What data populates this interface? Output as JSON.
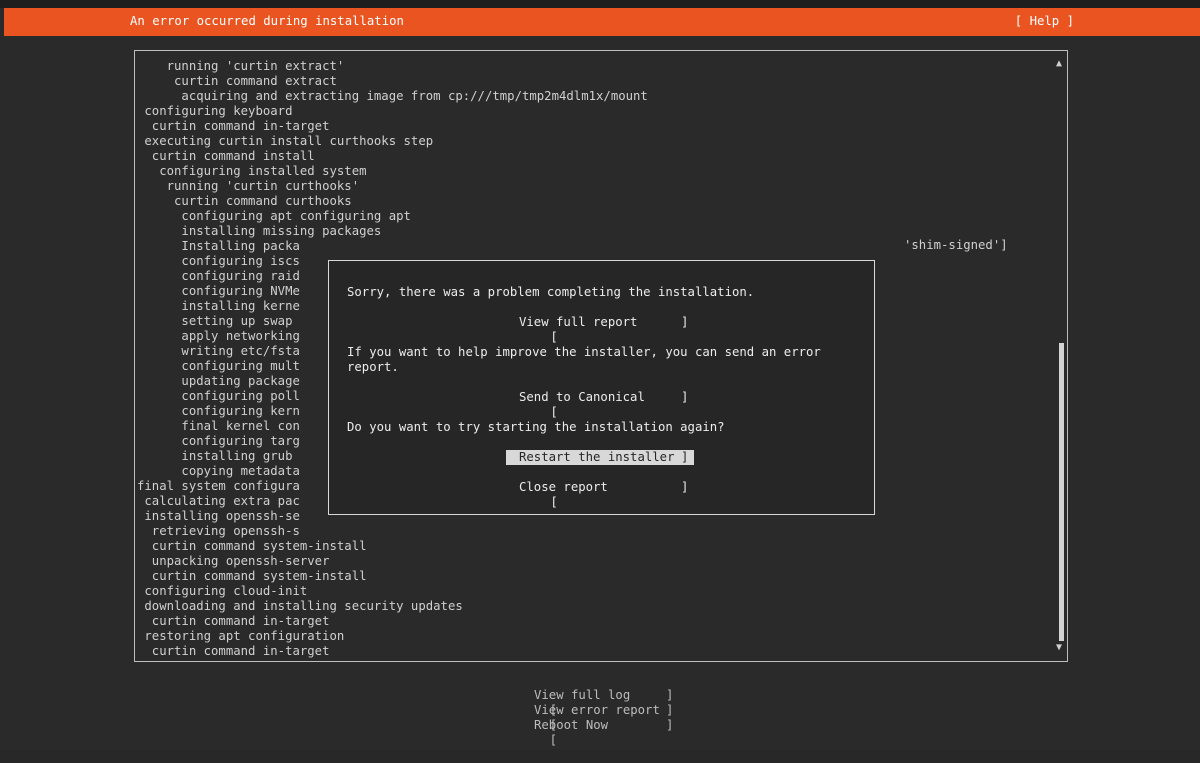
{
  "header": {
    "title": "An error occurred during installation",
    "help": "[ Help ]"
  },
  "log": {
    "lines": [
      "    running 'curtin extract'",
      "     curtin command extract",
      "      acquiring and extracting image from cp:///tmp/tmp2m4dlm1x/mount",
      " configuring keyboard",
      "  curtin command in-target",
      " executing curtin install curthooks step",
      "  curtin command install",
      "   configuring installed system",
      "    running 'curtin curthooks'",
      "     curtin command curthooks",
      "      configuring apt configuring apt",
      "      installing missing packages",
      "      Installing packa",
      "      configuring iscs",
      "      configuring raid",
      "      configuring NVMe",
      "      installing kerne",
      "      setting up swap",
      "      apply networking",
      "      writing etc/fsta",
      "      configuring mult",
      "      updating package",
      "      configuring poll",
      "      configuring kern",
      "      final kernel con",
      "      configuring targ",
      "      installing grub",
      "      copying metadata",
      "final system configura",
      " calculating extra pac",
      " installing openssh-se",
      "  retrieving openssh-s",
      "  curtin command system-install",
      "  unpacking openssh-server",
      "  curtin command system-install",
      " configuring cloud-init",
      " downloading and installing security updates",
      "  curtin command in-target",
      " restoring apt configuration",
      "  curtin command in-target"
    ],
    "side_text": "'shim-signed']"
  },
  "scrollbar": {
    "up": "▲",
    "down": "▼"
  },
  "dialog": {
    "message1": "Sorry, there was a problem completing the installation.",
    "view_full_report": "View full report",
    "message2_line1": "If you want to help improve the installer, you can send an error",
    "message2_line2": "report.",
    "send_to_canonical": "Send to Canonical",
    "message3": "Do you want to try starting the installation again?",
    "restart_installer": "Restart the installer",
    "close_report": "Close report"
  },
  "bottom": {
    "view_full_log": "View full log",
    "view_error_report": "View error report",
    "reboot_now": "Reboot Now"
  },
  "brackets": {
    "open": "[",
    "close": "]"
  }
}
